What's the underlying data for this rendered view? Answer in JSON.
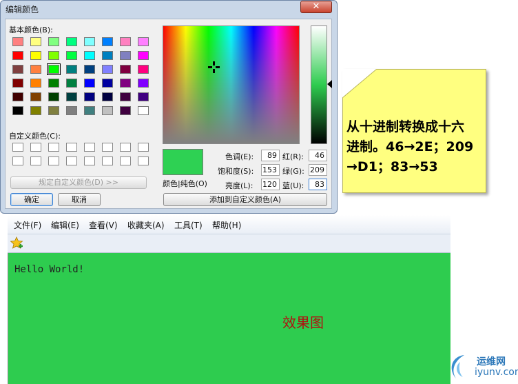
{
  "dialog": {
    "title": "编辑颜色",
    "close_glyph": "✕",
    "basic_colors_label": "基本颜色(B):",
    "custom_colors_label": "自定义颜色(C):",
    "define_custom_button": "规定自定义颜色(D) >>",
    "ok_button": "确定",
    "cancel_button": "取消",
    "color_solid_label": "颜色|纯色(O)",
    "add_custom_button": "添加到自定义颜色(A)",
    "basic_colors": [
      [
        "#ff8080",
        "#ffff80",
        "#80ff80",
        "#00ff80",
        "#80ffff",
        "#0080ff",
        "#ff80c0",
        "#ff80ff"
      ],
      [
        "#ff0000",
        "#ffff00",
        "#80ff00",
        "#00ff40",
        "#00ffff",
        "#0080c0",
        "#8080c0",
        "#ff00ff"
      ],
      [
        "#804040",
        "#ff8040",
        "#00ff00",
        "#008080",
        "#004080",
        "#8080ff",
        "#800040",
        "#ff0080"
      ],
      [
        "#800000",
        "#ff8000",
        "#008000",
        "#008040",
        "#0000ff",
        "#0000a0",
        "#800080",
        "#8000ff"
      ],
      [
        "#400000",
        "#804000",
        "#004000",
        "#004040",
        "#000080",
        "#000040",
        "#400040",
        "#400080"
      ],
      [
        "#000000",
        "#808000",
        "#808040",
        "#808080",
        "#408080",
        "#c0c0c0",
        "#400040",
        "#ffffff"
      ]
    ],
    "selected_swatch": [
      2,
      2
    ],
    "preview_color": "#2ed153",
    "fields": {
      "hue": {
        "label": "色调(E):",
        "value": "89"
      },
      "sat": {
        "label": "饱和度(S):",
        "value": "153"
      },
      "lum": {
        "label": "亮度(L):",
        "value": "120"
      },
      "red": {
        "label": "红(R):",
        "value": "46"
      },
      "green": {
        "label": "绿(G):",
        "value": "209"
      },
      "blue": {
        "label": "蓝(U):",
        "value": "83"
      }
    }
  },
  "note": {
    "line1": "从十进制转换成十六",
    "line2": "进制。46→2E；209",
    "line3": "→D1；83→53"
  },
  "browser": {
    "menu": [
      "文件(F)",
      "编辑(E)",
      "查看(V)",
      "收藏夹(A)",
      "工具(T)",
      "帮助(H)"
    ],
    "background": "#2ecc4f",
    "content_text": "Hello World!",
    "caption": "效果图"
  },
  "watermark": {
    "top": "运维网",
    "bottom": "iyunv.com"
  },
  "icons": {
    "favorites": "favorites-star-icon",
    "close": "close-icon",
    "crosshair": "crosshair-icon",
    "logo": "yunwei-logo-icon"
  }
}
